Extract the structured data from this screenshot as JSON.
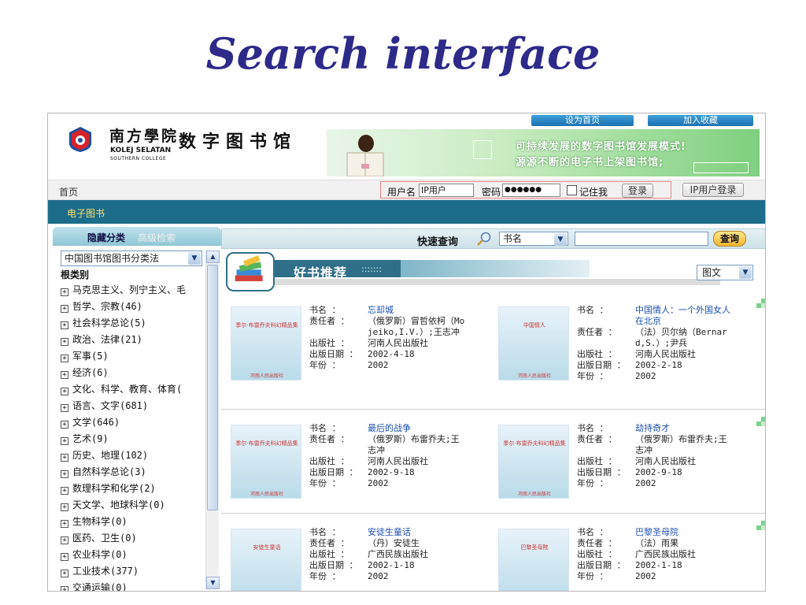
{
  "slide": {
    "title": "Search interface"
  },
  "header": {
    "logo_cn": "南方學院",
    "logo_en1": "KOLEJ SELATAN",
    "logo_en2": "SOUTHERN COLLEGE",
    "site_name": "数字图书馆",
    "toplinks": [
      "设为首页",
      "加入收藏"
    ],
    "banner_line1": "可持续发展的数字图书馆发展模式!",
    "banner_line2": "源源不断的电子书上架图书馆;"
  },
  "loginbar": {
    "home": "首页",
    "username_label": "用户名",
    "username_value": "IP用户",
    "password_label": "密码",
    "password_value": "●●●●●●",
    "remember_label": "记住我",
    "login_button": "登录",
    "ip_login_button": "IP用户登录"
  },
  "navbar": {
    "item": "电子图书"
  },
  "sidebar": {
    "tab_hide": "隐藏分类",
    "tab_advanced": "高级检索",
    "category_select": "中国图书馆图书分类法",
    "root": "根类别",
    "items": [
      "马克思主义、列宁主义、毛",
      "哲学、宗教(46)",
      "社会科学总论(5)",
      "政治、法律(21)",
      "军事(5)",
      "经济(6)",
      "文化、科学、教育、体育(",
      "语言、文字(681)",
      "文学(646)",
      "艺术(9)",
      "历史、地理(102)",
      "自然科学总论(3)",
      "数理科学和化学(2)",
      "天文学、地球科学(0)",
      "生物科学(0)",
      "医药、卫生(0)",
      "农业科学(0)",
      "工业技术(377)",
      "交通运输(0)"
    ]
  },
  "search": {
    "label": "快速查询",
    "field": "书名",
    "query": "",
    "button": "查询"
  },
  "recommend": {
    "title": "好书推荐",
    "dots": ":::::::",
    "view_mode": "图文"
  },
  "labels": {
    "title": "书名 ：",
    "author": "责任者 ：",
    "publisher": "出版社 ：",
    "date": "出版日期 ：",
    "year": "年份 ："
  },
  "books": [
    {
      "title": "忘却城",
      "author": "（俄罗斯）冒哲依柯（Mojeiko,I.V.）;王志冲",
      "publisher": "河南人民出版社",
      "date": "2002-4-18",
      "year": "2002",
      "cover_text": "季尔·布雷乔夫科幻精品集",
      "cover_pub": "河南人民出版社"
    },
    {
      "title": "中国情人：一个外国女人在北京",
      "author": "（法）贝尔纳（Bernard,S.）;尹兵",
      "publisher": "河南人民出版社",
      "date": "2002-2-18",
      "year": "2002",
      "cover_text": "中国情人",
      "cover_pub": "河南人民出版社"
    },
    {
      "title": "最后的战争",
      "author": "（俄罗斯）布雷乔夫;王志冲",
      "publisher": "河南人民出版社",
      "date": "2002-9-18",
      "year": "2002",
      "cover_text": "季尔·布雷乔夫科幻精品集",
      "cover_pub": "河南人民出版社"
    },
    {
      "title": "劫持奇才",
      "author": "（俄罗斯）布雷乔夫;王志冲",
      "publisher": "河南人民出版社",
      "date": "2002-9-18",
      "year": "2002",
      "cover_text": "季尔·布雷乔夫科幻精品集",
      "cover_pub": "河南人民出版社"
    },
    {
      "title": "安徒生童话",
      "author": "（丹）安徒生",
      "publisher": "广西民族出版社",
      "date": "2002-1-18",
      "year": "2002",
      "cover_text": "安徒生童话",
      "cover_pub": ""
    },
    {
      "title": "巴黎圣母院",
      "author": "（法）雨果",
      "publisher": "广西民族出版社",
      "date": "2002-1-18",
      "year": "2002",
      "cover_text": "巴黎圣母院",
      "cover_pub": ""
    }
  ],
  "colors": {
    "title": "#2e2a8a",
    "navbar": "#1c6d8a",
    "nav_text": "#ffe06a",
    "link": "#1b4fb3",
    "corner_green": "#7fcf8f"
  }
}
